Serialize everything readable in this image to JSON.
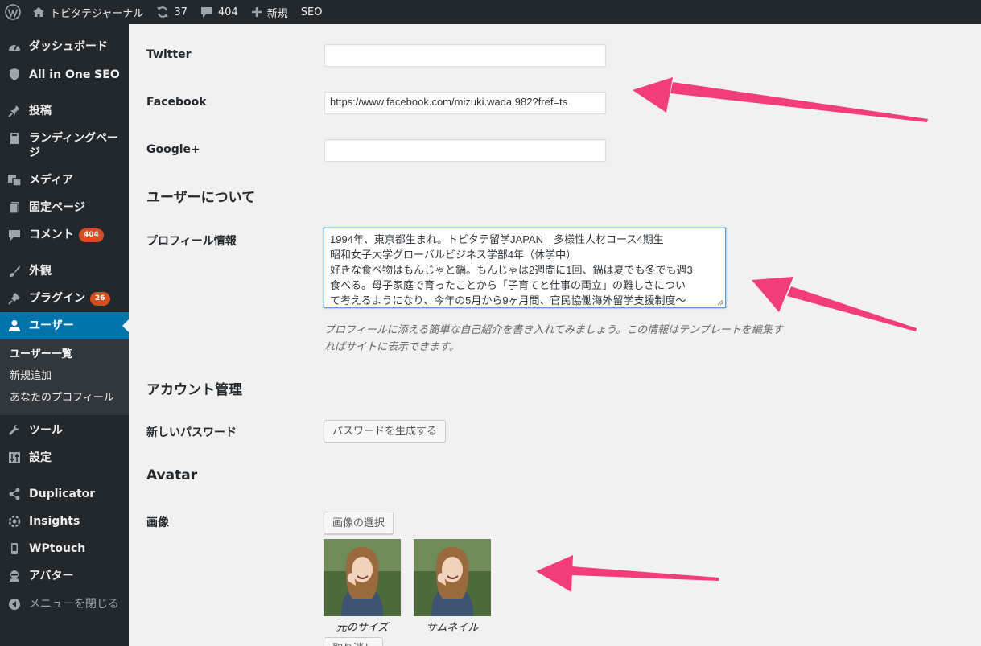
{
  "adminbar": {
    "site_name": "トビタテジャーナル",
    "updates_count": "37",
    "comments_count": "404",
    "new_label": "新規",
    "seo_label": "SEO"
  },
  "sidebar": {
    "items": [
      {
        "label": "ダッシュボード",
        "icon": "dashboard-icon"
      },
      {
        "label": "All in One SEO",
        "icon": "shield-icon"
      },
      {
        "label": "投稿",
        "icon": "pin-icon"
      },
      {
        "label": "ランディングページ",
        "icon": "book-icon"
      },
      {
        "label": "メディア",
        "icon": "media-icon"
      },
      {
        "label": "固定ページ",
        "icon": "page-icon"
      },
      {
        "label": "コメント",
        "icon": "comment-icon",
        "badge": "404"
      },
      {
        "label": "外観",
        "icon": "brush-icon"
      },
      {
        "label": "プラグイン",
        "icon": "plugin-icon",
        "badge": "26"
      },
      {
        "label": "ユーザー",
        "icon": "user-icon"
      },
      {
        "label": "ツール",
        "icon": "wrench-icon"
      },
      {
        "label": "設定",
        "icon": "sliders-icon"
      },
      {
        "label": "Duplicator",
        "icon": "share-icon"
      },
      {
        "label": "Insights",
        "icon": "gear-icon"
      },
      {
        "label": "WPtouch",
        "icon": "phone-icon"
      },
      {
        "label": "アバター",
        "icon": "ninja-icon"
      },
      {
        "label": "メニューを閉じる",
        "icon": "collapse-arrow-icon"
      }
    ],
    "submenu": [
      "ユーザー一覧",
      "新規追加",
      "あなたのプロフィール"
    ]
  },
  "form": {
    "twitter_label": "Twitter",
    "twitter_value": "",
    "facebook_label": "Facebook",
    "facebook_value": "https://www.facebook.com/mizuki.wada.982?fref=ts",
    "googleplus_label": "Google+",
    "googleplus_value": "",
    "about_title": "ユーザーについて",
    "profile_label": "プロフィール情報",
    "profile_lines": [
      "1994年、東京都生まれ。トビタテ留学JAPAN　多様性人材コース4期生",
      "昭和女子大学グローバルビジネス学部4年（休学中）",
      "好きな食べ物はもんじゃと鍋。もんじゃは2週間に1回、鍋は夏でも冬でも週3",
      "食べる。母子家庭で育ったことから「子育てと仕事の両立」の難しさについ",
      "て考えるようになり、今年の5月から9ヶ月間、官民協働海外留学支援制度〜"
    ],
    "profile_description_1": "プロフィールに添える簡単な自己紹介を書き入れてみましょう。この情報はテンプレートを編集す",
    "profile_description_2": "ればサイトに表示できます。",
    "account_title": "アカウント管理",
    "password_label": "新しいパスワード",
    "password_button": "パスワードを生成する",
    "avatar_title": "Avatar",
    "image_label": "画像",
    "image_select_button": "画像の選択",
    "original_size_caption": "元のサイズ",
    "thumbnail_caption": "サムネイル",
    "remove_button": "取り消し"
  },
  "colors": {
    "admin_bg": "#23282d",
    "accent": "#0073aa",
    "badge": "#d54e21",
    "arrow": "#f23d7a"
  }
}
